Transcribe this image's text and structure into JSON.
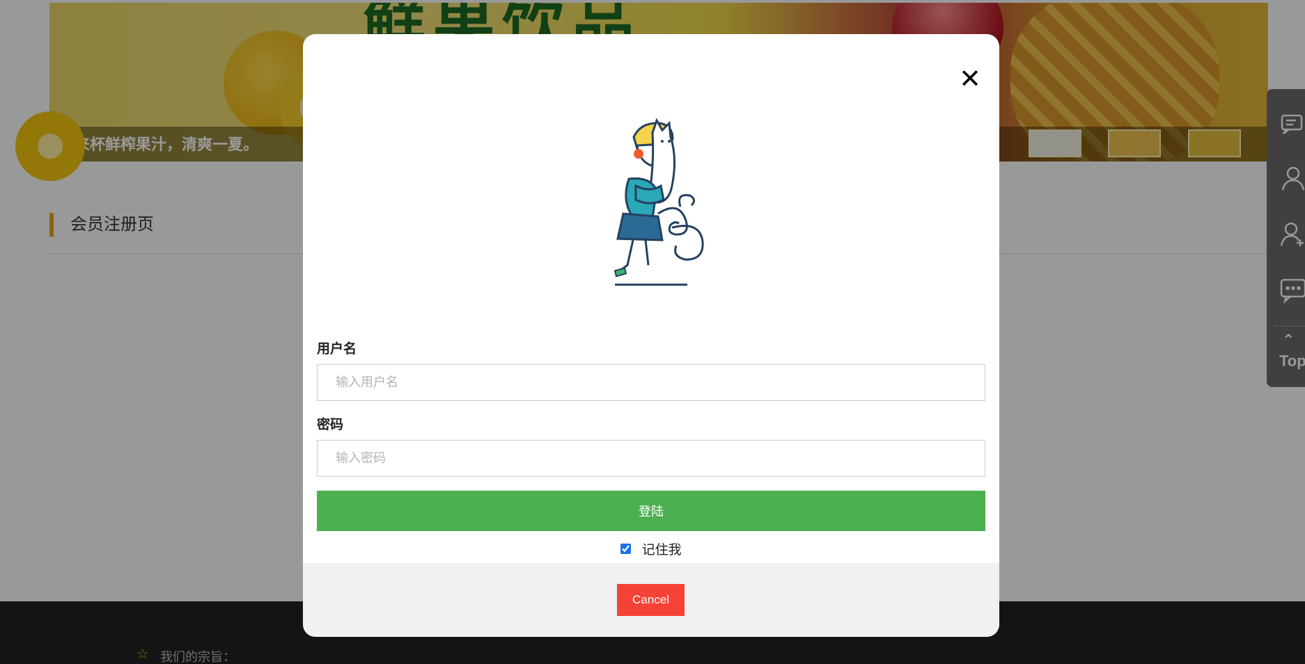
{
  "page": {
    "banner_caption": "来杯鲜榨果汁，清爽一夏。",
    "banner_headline": "鲜果饮品",
    "section_title": "会员注册页",
    "footer_text": "我们的宗旨："
  },
  "sidebar": {
    "top_label": "Top",
    "items": [
      {
        "icon": "message-list-icon"
      },
      {
        "icon": "user-icon"
      },
      {
        "icon": "add-user-icon"
      },
      {
        "icon": "chat-bubble-icon"
      },
      {
        "icon": "back-to-top-icon"
      }
    ]
  },
  "modal": {
    "close_symbol": "✕",
    "username_label": "用户名",
    "username_placeholder": "输入用户名",
    "username_value": "",
    "password_label": "密码",
    "password_placeholder": "输入密码",
    "password_value": "",
    "login_label": "登陆",
    "remember_label": "记住我",
    "remember_checked": true,
    "cancel_label": "Cancel"
  },
  "colors": {
    "login_button": "#4caf50",
    "cancel_button": "#f44336",
    "section_accent": "#f0a500",
    "sidebar_bg": "#6b6b6b",
    "footer_bg": "#222222"
  }
}
